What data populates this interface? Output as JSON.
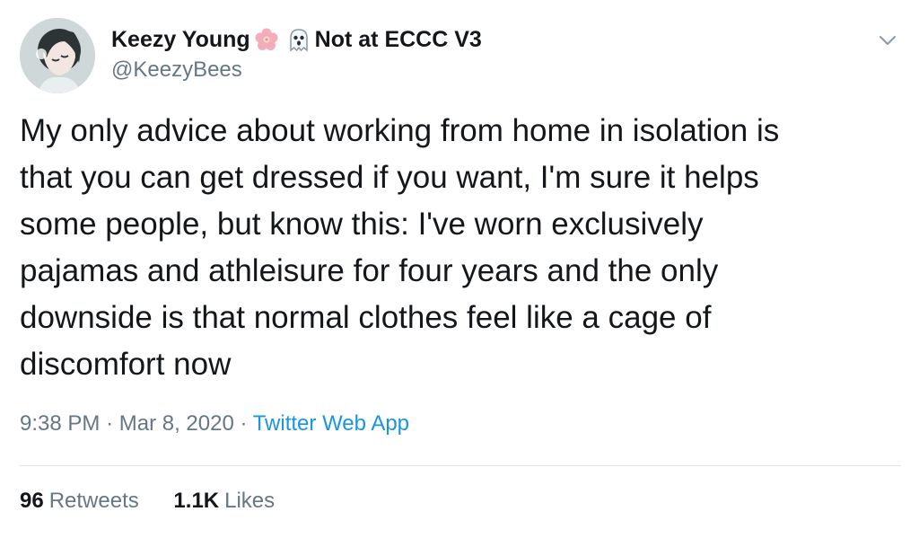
{
  "author": {
    "display_name": "Keezy Young",
    "name_suffix": "Not at ECCC V3",
    "emoji_1": "cherry-blossom-icon",
    "emoji_2": "ghost-icon",
    "handle": "@KeezyBees"
  },
  "tweet": {
    "text": "My only advice about working from home in isolation is\nthat you can get dressed if you want, I'm sure it helps\nsome people, but know this: I've worn exclusively\npajamas and athleisure for four years and the only\ndownside is that normal clothes feel like a cage of\ndiscomfort now",
    "time": "9:38 PM",
    "separator": "·",
    "date": "Mar 8, 2020",
    "source": "Twitter Web App"
  },
  "stats": {
    "retweets_count": "96",
    "retweets_label": "Retweets",
    "likes_count": "1.1K",
    "likes_label": "Likes"
  },
  "colors": {
    "text": "#14171a",
    "secondary": "#657786",
    "link": "#1b95e0",
    "divider": "#e1e8ed"
  }
}
